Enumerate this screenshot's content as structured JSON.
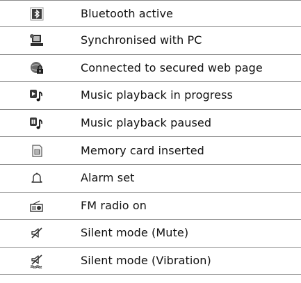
{
  "rows": [
    {
      "icon": "bluetooth-icon",
      "label": "Bluetooth active"
    },
    {
      "icon": "pc-sync-icon",
      "label": "Synchronised with PC"
    },
    {
      "icon": "secure-web-icon",
      "label": "Connected to secured web page"
    },
    {
      "icon": "music-play-icon",
      "label": "Music playback in progress"
    },
    {
      "icon": "music-pause-icon",
      "label": "Music playback paused"
    },
    {
      "icon": "memory-card-icon",
      "label": "Memory card inserted"
    },
    {
      "icon": "alarm-bell-icon",
      "label": "Alarm set"
    },
    {
      "icon": "fm-radio-icon",
      "label": "FM radio on"
    },
    {
      "icon": "silent-mute-icon",
      "label": "Silent mode (Mute)"
    },
    {
      "icon": "silent-vibration-icon",
      "label": "Silent mode (Vibration)"
    }
  ]
}
